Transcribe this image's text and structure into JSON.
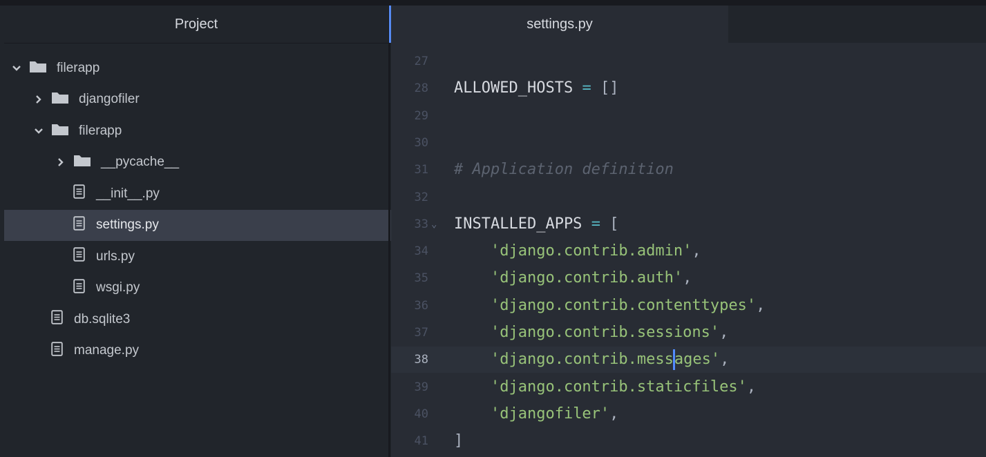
{
  "sidebar": {
    "title": "Project",
    "items": [
      {
        "label": "filerapp",
        "type": "folder",
        "expanded": true,
        "chevron": "chevron-down-icon",
        "selected": false
      },
      {
        "label": "djangofiler",
        "type": "folder",
        "expanded": false,
        "chevron": "chevron-right-icon",
        "selected": false
      },
      {
        "label": "filerapp",
        "type": "folder",
        "expanded": true,
        "chevron": "chevron-down-icon",
        "selected": false
      },
      {
        "label": "__pycache__",
        "type": "folder",
        "expanded": false,
        "chevron": "chevron-right-icon",
        "selected": false
      },
      {
        "label": "__init__.py",
        "type": "file",
        "selected": false
      },
      {
        "label": "settings.py",
        "type": "file",
        "selected": true
      },
      {
        "label": "urls.py",
        "type": "file",
        "selected": false
      },
      {
        "label": "wsgi.py",
        "type": "file",
        "selected": false
      },
      {
        "label": "db.sqlite3",
        "type": "file",
        "selected": false
      },
      {
        "label": "manage.py",
        "type": "file",
        "selected": false
      }
    ]
  },
  "editor": {
    "tab_title": "settings.py",
    "lines": [
      {
        "num": "27",
        "code": ""
      },
      {
        "num": "28",
        "code": "ALLOWED_HOSTS = []"
      },
      {
        "num": "29",
        "code": ""
      },
      {
        "num": "30",
        "code": ""
      },
      {
        "num": "31",
        "code": "# Application definition"
      },
      {
        "num": "32",
        "code": ""
      },
      {
        "num": "33",
        "code": "INSTALLED_APPS = [",
        "foldable": true
      },
      {
        "num": "34",
        "code": "    'django.contrib.admin',"
      },
      {
        "num": "35",
        "code": "    'django.contrib.auth',"
      },
      {
        "num": "36",
        "code": "    'django.contrib.contenttypes',"
      },
      {
        "num": "37",
        "code": "    'django.contrib.sessions',"
      },
      {
        "num": "38",
        "code": "    'django.contrib.messages',",
        "current": true
      },
      {
        "num": "39",
        "code": "    'django.contrib.staticfiles',"
      },
      {
        "num": "40",
        "code": "    'djangofiler',"
      },
      {
        "num": "41",
        "code": "]"
      }
    ]
  },
  "colors": {
    "background": "#282c34",
    "sidebar": "#21252b",
    "selection": "#3a3f4b",
    "accent": "#568af2",
    "string": "#98c379",
    "operator": "#56b6c2",
    "comment": "#5c6370",
    "line_number": "#4b5263"
  }
}
